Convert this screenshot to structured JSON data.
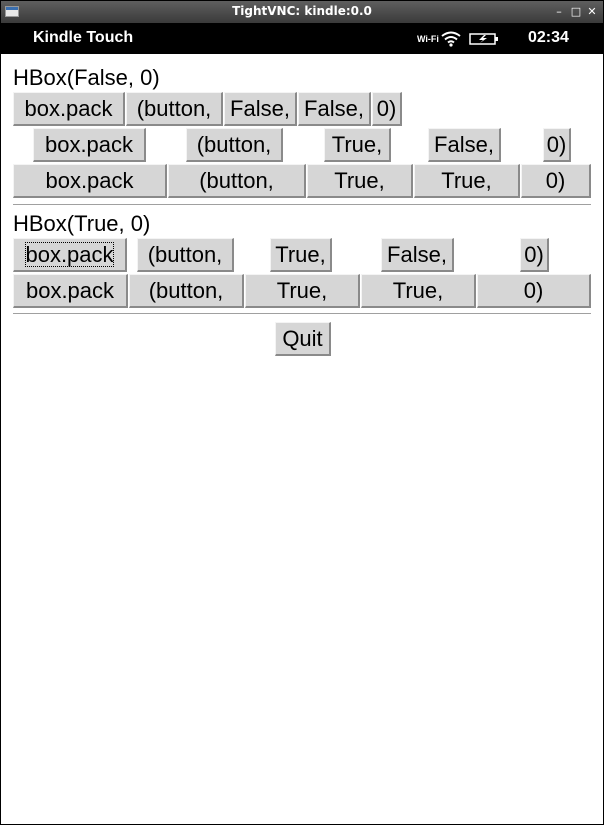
{
  "window": {
    "title": "TightVNC: kindle:0.0"
  },
  "statusbar": {
    "app_name": "Kindle Touch",
    "wifi_label": "Wi-Fi",
    "time": "02:34"
  },
  "section1": {
    "label": "HBox(False, 0)",
    "rows": [
      {
        "buttons": [
          "box.pack",
          "(button,",
          "False,",
          "False,",
          "0)"
        ]
      },
      {
        "buttons": [
          "box.pack",
          "(button,",
          "True,",
          "False,",
          "0)"
        ]
      },
      {
        "buttons": [
          "box.pack",
          "(button,",
          "True,",
          "True,",
          "0)"
        ]
      }
    ]
  },
  "section2": {
    "label": "HBox(True, 0)",
    "rows": [
      {
        "buttons": [
          "box.pack",
          "(button,",
          "True,",
          "False,",
          "0)"
        ]
      },
      {
        "buttons": [
          "box.pack",
          "(button,",
          "True,",
          "True,",
          "0)"
        ]
      }
    ]
  },
  "quit": {
    "label": "Quit"
  }
}
